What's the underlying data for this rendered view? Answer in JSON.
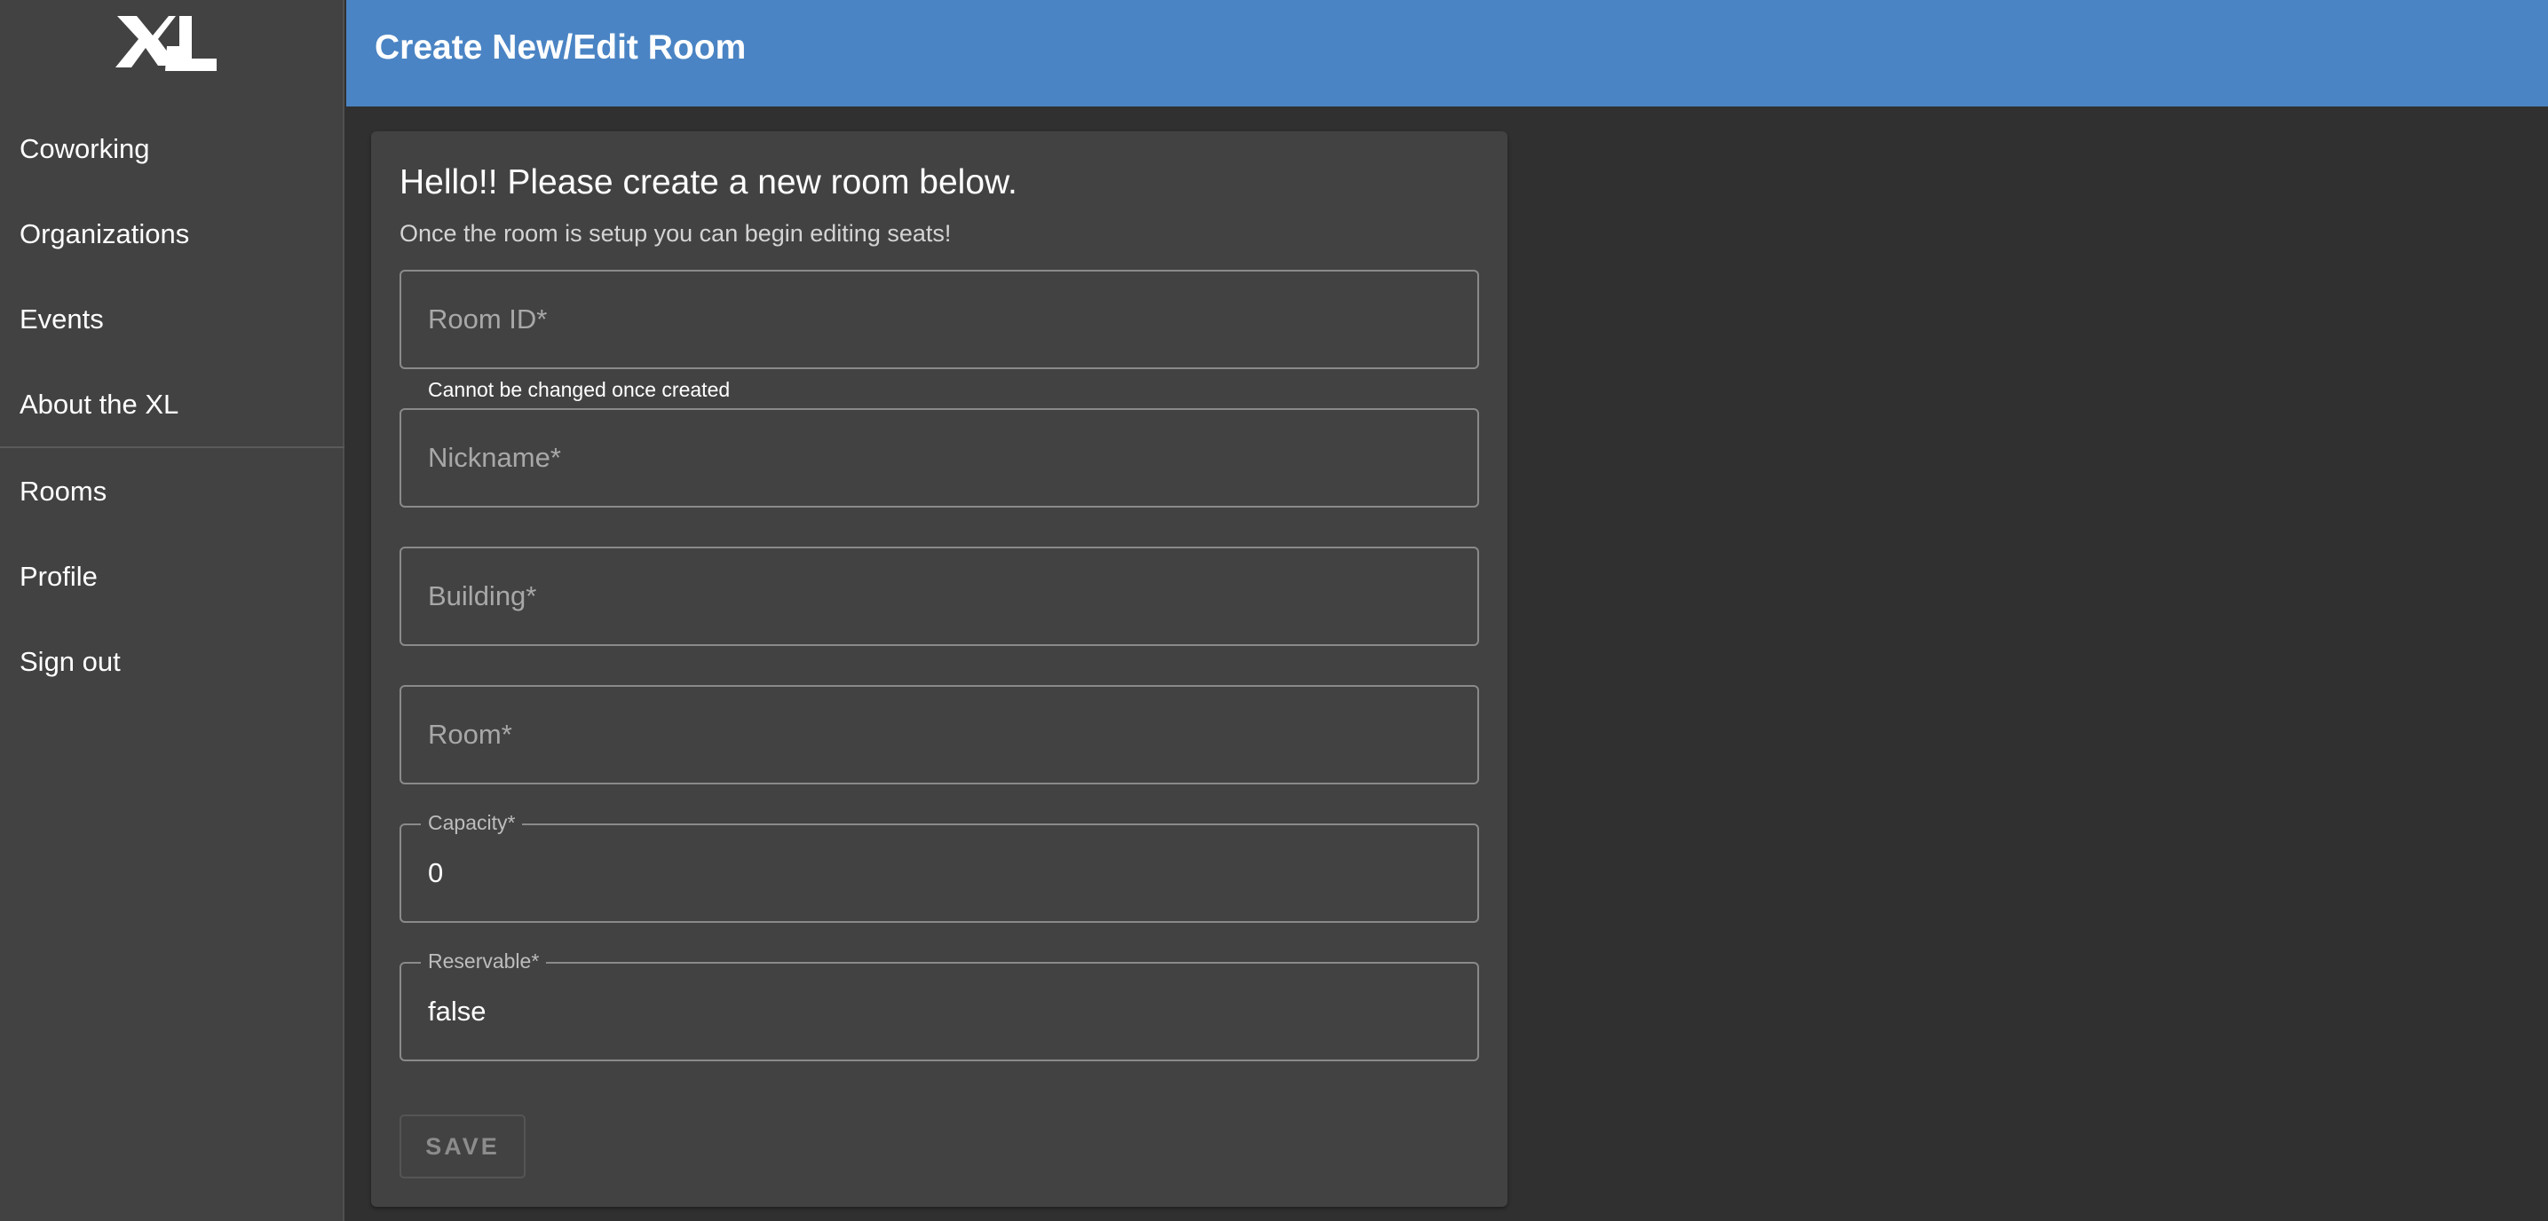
{
  "sidebar": {
    "logo_icon": "xl-logo-icon",
    "items": [
      {
        "label": "Coworking"
      },
      {
        "label": "Organizations"
      },
      {
        "label": "Events"
      },
      {
        "label": "About the XL"
      },
      {
        "label": "Rooms"
      },
      {
        "label": "Profile"
      },
      {
        "label": "Sign out"
      }
    ]
  },
  "header": {
    "title": "Create New/Edit Room",
    "color": "#4a84c4"
  },
  "form": {
    "title": "Hello!! Please create a new room below.",
    "subtitle": "Once the room is setup you can begin editing seats!",
    "room_id": {
      "placeholder": "Room ID*",
      "helper": "Cannot be changed once created"
    },
    "nickname": {
      "placeholder": "Nickname*"
    },
    "building": {
      "placeholder": "Building*"
    },
    "room": {
      "placeholder": "Room*"
    },
    "capacity": {
      "label": "Capacity*",
      "value": "0"
    },
    "reservable": {
      "label": "Reservable*",
      "value": "false"
    },
    "save_label": "SAVE",
    "save_disabled": true
  }
}
